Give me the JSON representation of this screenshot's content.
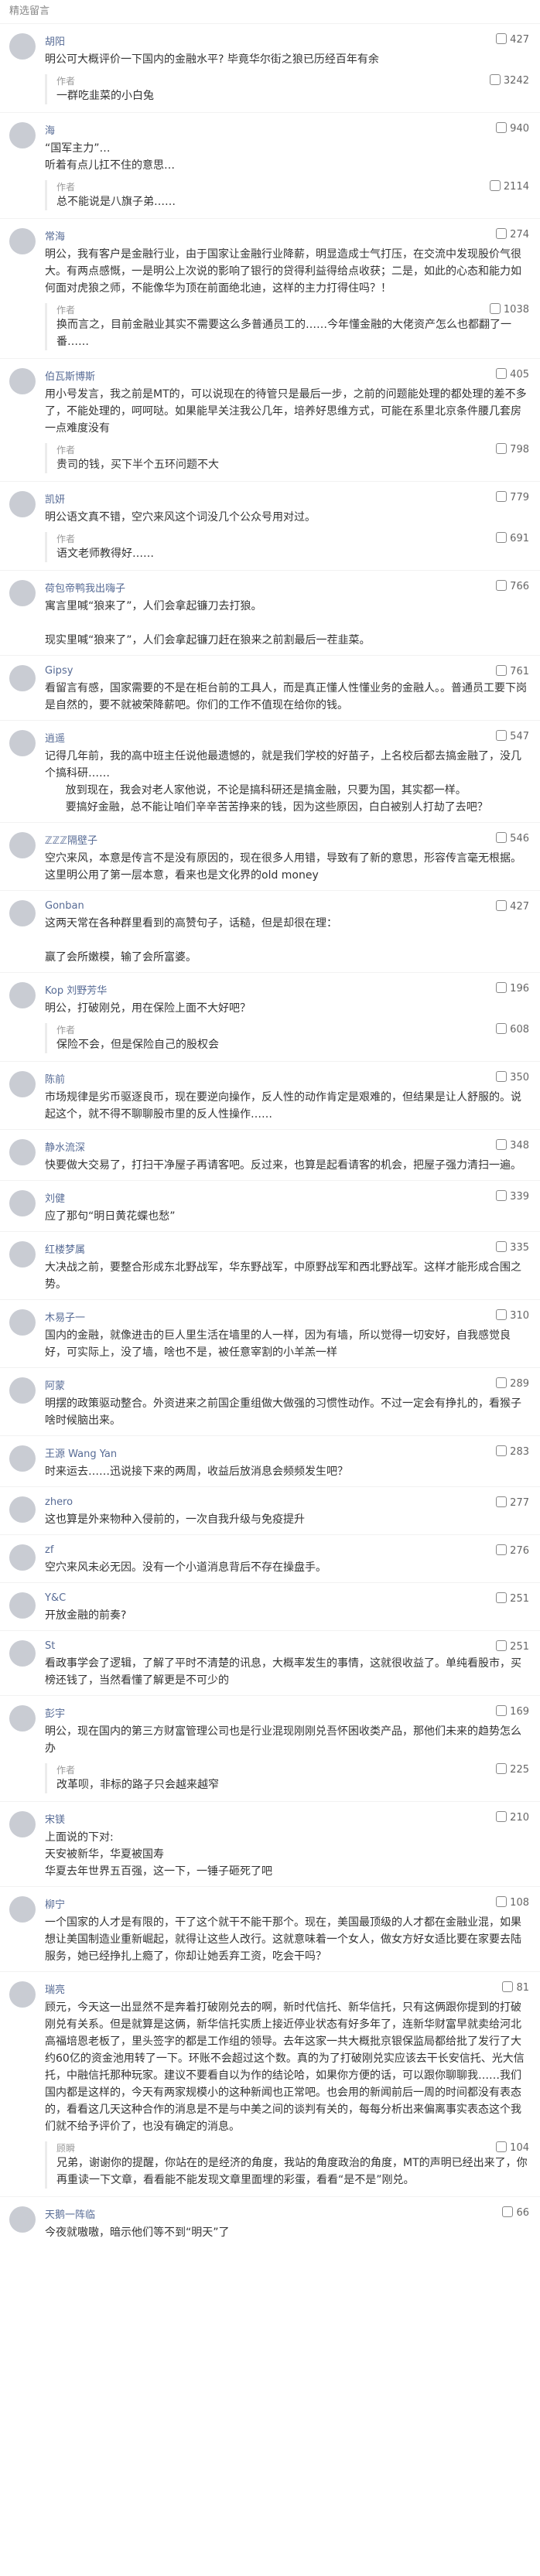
{
  "section_title": "精选留言",
  "comments": [
    {
      "name": "胡阳",
      "likes": "427",
      "text": "明公可大概评价一下国内的金融水平? 毕竟华尔街之狼已历经百年有余",
      "reply": {
        "name": "作者",
        "likes": "3242",
        "text": "一群吃韭菜的小白兔"
      }
    },
    {
      "name": "海",
      "likes": "940",
      "text": "“国军主力”…\n听着有点儿扛不住的意思…",
      "reply": {
        "name": "作者",
        "likes": "2114",
        "text": "总不能说是八旗子弟……"
      }
    },
    {
      "name": "常海",
      "likes": "274",
      "text": "明公，我有客户是金融行业，由于国家让金融行业降薪，明显造成士气打压，在交流中发现股价气很大。有两点感慨，一是明公上次说的影响了银行的贷得利益得给点收获；二是，如此的心态和能力如何面对虎狼之师，不能像华为顶在前面绝北迪，这样的主力打得住吗？！",
      "reply": {
        "name": "作者",
        "likes": "1038",
        "text": "换而言之，目前金融业其实不需要这么多普通员工的……今年懂金融的大佬资产怎么也都翻了一番……"
      }
    },
    {
      "name": "伯瓦斯博斯",
      "likes": "405",
      "text": "用小号发言，我之前是MT的，可以说现在的待管只是最后一步，之前的问题能处理的都处理的差不多了，不能处理的，呵呵哒。如果能早关注我公几年，培养好思维方式，可能在系里北京条件腰几套房一点难度没有",
      "reply": {
        "name": "作者",
        "likes": "798",
        "text": "贵司的钱，买下半个五环问题不大"
      }
    },
    {
      "name": "凯妍",
      "likes": "779",
      "text": "明公语文真不错，空穴来风这个词没几个公众号用对过。",
      "reply": {
        "name": "作者",
        "likes": "691",
        "text": "语文老师教得好……"
      }
    },
    {
      "name": "荷包帝鸭我出嗨子",
      "likes": "766",
      "text": "寓言里喊“狼来了”，人们会拿起镰刀去打狼。\n\n现实里喊“狼来了”，人们会拿起镰刀赶在狼来之前割最后一茬韭菜。",
      "reply": null
    },
    {
      "name": "Gipsy",
      "likes": "761",
      "text": "看留言有感，国家需要的不是在柜台前的工具人，而是真正懂人性懂业务的金融人。。普通员工要下岗是自然的，要不就被荣降薪吧。你们的工作不值现在给你的钱。",
      "reply": null
    },
    {
      "name": "逍遥",
      "likes": "547",
      "text": "记得几年前，我的高中班主任说他最遗憾的，就是我们学校的好苗子，上名校后都去搞金融了，没几个搞科研……\n      放到现在，我会对老人家他说，不论是搞科研还是搞金融，只要为国，其实都一样。\n      要搞好金融，总不能让咱们辛辛苦苦挣来的钱，因为这些原因，白白被别人打劫了去吧？",
      "reply": null
    },
    {
      "name": "ℤℤℤ隔壁子",
      "likes": "546",
      "text": "空穴来风，本意是传言不是没有原因的，现在很多人用错，导致有了新的意思，形容传言毫无根据。这里明公用了第一层本意，看来也是文化界的old money",
      "reply": null
    },
    {
      "name": "Gonban",
      "likes": "427",
      "text": "这两天常在各种群里看到的高赞句子，话糙，但是却很在理：\n\n赢了会所嫩模，输了会所富婆。",
      "reply": null
    },
    {
      "name": "Kop 刘野芳华",
      "likes": "196",
      "text": "明公，打破刚兑，用在保险上面不大好吧？",
      "reply": {
        "name": "作者",
        "likes": "608",
        "text": "保险不会，但是保险自己的股权会"
      }
    },
    {
      "name": "陈前",
      "likes": "350",
      "text": "市场规律是劣币驱逐良币，现在要逆向操作，反人性的动作肯定是艰难的，但结果是让人舒服的。说起这个，就不得不聊聊股市里的反人性操作……",
      "reply": null
    },
    {
      "name": "静水流深",
      "likes": "348",
      "text": "快要做大交易了，打扫干净屋子再请客吧。反过来，也算是起看请客的机会，把屋子强力清扫一遍。",
      "reply": null
    },
    {
      "name": "刘健",
      "likes": "339",
      "text": "应了那句“明日黄花蝶也愁”",
      "reply": null
    },
    {
      "name": "红楼梦属",
      "likes": "335",
      "text": "大决战之前，要整合形成东北野战军，华东野战军，中原野战军和西北野战军。这样才能形成合围之势。",
      "reply": null
    },
    {
      "name": "木易子一",
      "likes": "310",
      "text": "国内的金融，就像进击的巨人里生活在墙里的人一样，因为有墙，所以觉得一切安好，自我感觉良好，可实际上，没了墙，啥也不是，被任意宰割的小羊羔一样",
      "reply": null
    },
    {
      "name": "阿蒙",
      "likes": "289",
      "text": "明摆的政策驱动整合。外资进来之前国企重组做大做强的习惯性动作。不过一定会有挣扎的，看猴子啥时候脑出来。",
      "reply": null
    },
    {
      "name": "王源 Wang Yan",
      "likes": "283",
      "text": "时来运去……迅说接下来的两周，收益后放消息会频频发生吧？",
      "reply": null
    },
    {
      "name": "zhero",
      "likes": "277",
      "text": "这也算是外来物种入侵前的，一次自我升级与免疫提升",
      "reply": null
    },
    {
      "name": "zf",
      "likes": "276",
      "text": "空穴来风未必无因。没有一个小道消息背后不存在操盘手。",
      "reply": null
    },
    {
      "name": "Y&C",
      "likes": "251",
      "text": "开放金融的前奏?",
      "reply": null
    },
    {
      "name": "St",
      "likes": "251",
      "text": "看政事学会了逻辑，了解了平时不清楚的讯息，大概率发生的事情，这就很收益了。单纯看股市，买榜还钱了，当然看懂了解更是不可少的",
      "reply": null
    },
    {
      "name": "彭宇",
      "likes": "169",
      "text": "明公，现在国内的第三方财富管理公司也是行业混现刚刚兑吾怀困收类产品，那他们未来的趋势怎么办",
      "reply": {
        "name": "作者",
        "likes": "225",
        "text": "改革呗，非标的路子只会越来越窄"
      }
    },
    {
      "name": "宋镁",
      "likes": "210",
      "text": "上面说的下对:\n天安被新华，华夏被国寿\n华夏去年世界五百强，这一下，一锤子砸死了吧",
      "reply": null
    },
    {
      "name": "柳宁",
      "likes": "108",
      "text": "一个国家的人才是有限的，干了这个就干不能干那个。现在，美国最顶级的人才都在金融业混，如果想让美国制造业重新崛起，就得让这些人改行。这就意味着一个女人，做女方好女适比要在家要去陆服务，她已经挣扎上瘾了，你却让她丢弃工资，吃会干吗？",
      "reply": null
    },
    {
      "name": "瑞亮",
      "likes": "81",
      "text": "顾元，今天这一出显然不是奔着打破刚兑去的啊，新时代信托、新华信托，只有这俩跟你提到的打破刚兑有关系。但是就算是这俩，新华信托实质上接近停业状态有好多年了，连新华财富早就卖给河北高福培恩老板了，里头签字的都是工作组的领导。去年这家一共大概批京银保监局都给批了发行了大约60亿的资金池用转了一下。环账不会超过这个数。真的为了打破刚兑实应该去干长安信托、光大信托，中融信托那种玩家。建议不要看自以为作的结论哈，如果你方便的话，可以跟你聊聊我……我们国内都是这样的，今天有两家规模小的这种新闻也正常吧。也会用的新闻前后一周的时间都没有表态的，看看这几天这种合作的消息是不是与中美之间的谈判有关的，每每分析出来偏离事实表态这个我们就不给予评价了，也没有确定的消息。",
      "reply": {
        "name": "顾瞬",
        "likes": "104",
        "text": "兄弟，谢谢你的提醒，你站在的是经济的角度，我站的角度政治的角度，MT的声明已经出来了，你再重读一下文章，看看能不能发现文章里面埋的彩蛋，看看“是不是”刚兑。"
      }
    },
    {
      "name": "天鹅一阵临",
      "likes": "66",
      "text": "今夜就嗷嗷，暗示他们等不到“明天”了",
      "reply": null
    }
  ]
}
